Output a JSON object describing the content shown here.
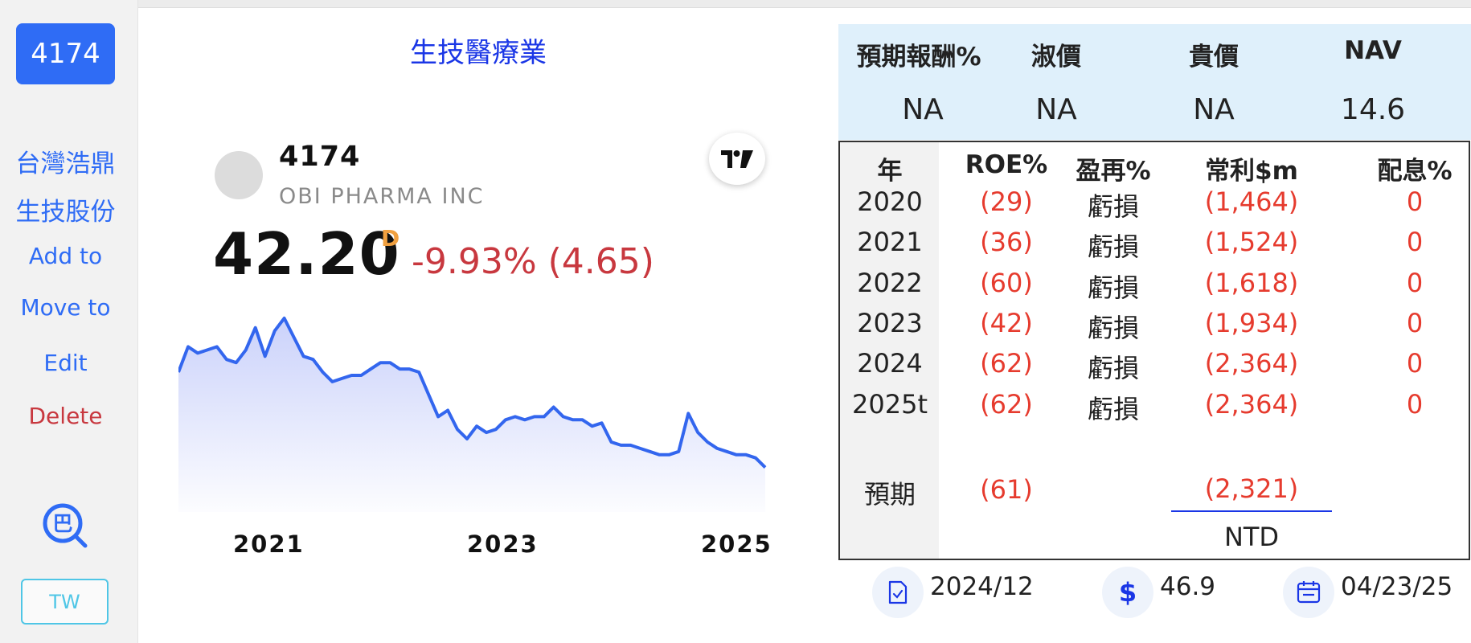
{
  "sidebar": {
    "ticker": "4174",
    "name_line1": "台灣浩鼎",
    "name_line2": "生技股份",
    "add_label": "Add to",
    "move_label": "Move to",
    "edit_label": "Edit",
    "delete_label": "Delete",
    "lens_icon": "search-zoom-icon",
    "lens_glyph": "巴",
    "market_label": "TW"
  },
  "quote": {
    "industry": "生技醫療業",
    "symbol": "4174",
    "company_name": "OBI PHARMA INC",
    "price": "42.20",
    "price_flag": "D",
    "change": "-9.93% (4.65)",
    "tradingview_icon": "tradingview-logo-icon"
  },
  "chart_data": {
    "type": "area",
    "x_labels": [
      "2021",
      "2023",
      "2025"
    ],
    "values": [
      72,
      80,
      78,
      79,
      80,
      76,
      75,
      79,
      86,
      77,
      85,
      89,
      83,
      77,
      76,
      72,
      69,
      70,
      71,
      71,
      73,
      75,
      75,
      73,
      73,
      72,
      65,
      58,
      60,
      54,
      51,
      55,
      53,
      54,
      57,
      58,
      57,
      58,
      58,
      61,
      58,
      57,
      57,
      55,
      56,
      50,
      49,
      49,
      48,
      47,
      46,
      46,
      47,
      59,
      53,
      50,
      48,
      47,
      46,
      46,
      45,
      42
    ],
    "line_color": "#3366ee",
    "fill_color": "#c5cdfa"
  },
  "metrics": {
    "headers": [
      "預期報酬%",
      "淑價",
      "貴價",
      "NAV"
    ],
    "values": [
      "NA",
      "NA",
      "NA",
      "14.6"
    ]
  },
  "financials": {
    "headers": [
      "年",
      "ROE%",
      "盈再%",
      "常利$m",
      "配息%"
    ],
    "rows": [
      {
        "year": "2020",
        "roe": "(29)",
        "reinvest": "虧損",
        "profit": "(1,464)",
        "dividend": "0"
      },
      {
        "year": "2021",
        "roe": "(36)",
        "reinvest": "虧損",
        "profit": "(1,524)",
        "dividend": "0"
      },
      {
        "year": "2022",
        "roe": "(60)",
        "reinvest": "虧損",
        "profit": "(1,618)",
        "dividend": "0"
      },
      {
        "year": "2023",
        "roe": "(42)",
        "reinvest": "虧損",
        "profit": "(1,934)",
        "dividend": "0"
      },
      {
        "year": "2024",
        "roe": "(62)",
        "reinvest": "虧損",
        "profit": "(2,364)",
        "dividend": "0"
      },
      {
        "year": "2025t",
        "roe": "(62)",
        "reinvest": "虧損",
        "profit": "(2,364)",
        "dividend": "0"
      }
    ],
    "expected": {
      "year": "預期",
      "roe": "(61)",
      "profit": "(2,321)"
    },
    "currency": "NTD",
    "colors": {
      "negative": "#e63b2e",
      "accent": "#1a36e6"
    }
  },
  "footer": {
    "report_period": "2024/12",
    "price_value": "46.9",
    "date": "04/23/25",
    "report_icon": "document-check-icon",
    "price_icon": "dollar-icon",
    "price_glyph": "$",
    "calendar_icon": "calendar-icon"
  }
}
